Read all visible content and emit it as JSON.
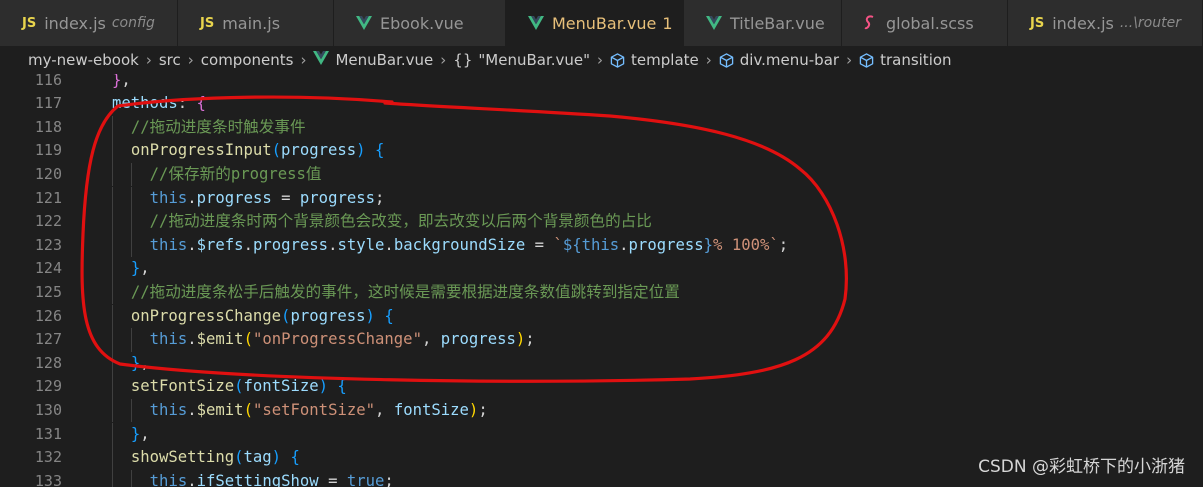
{
  "tabs": [
    {
      "icon": "js-file-icon",
      "label": "index.js",
      "description": "config",
      "active": false
    },
    {
      "icon": "js-file-icon",
      "label": "main.js",
      "active": false
    },
    {
      "icon": "vue-file-icon",
      "label": "Ebook.vue",
      "active": false
    },
    {
      "icon": "vue-file-icon",
      "label": "MenuBar.vue",
      "badge": "1",
      "active": true,
      "close": "✕"
    },
    {
      "icon": "vue-file-icon",
      "label": "TitleBar.vue",
      "active": false
    },
    {
      "icon": "scss-file-icon",
      "label": "global.scss",
      "active": false
    },
    {
      "icon": "js-file-icon",
      "label": "index.js",
      "description": "...\\router",
      "active": false
    }
  ],
  "breadcrumb": [
    "my-new-ebook",
    "src",
    "components",
    "MenuBar.vue",
    "\"MenuBar.vue\"",
    "template",
    "div.menu-bar",
    "transition"
  ],
  "code_lines": [
    {
      "num": "116",
      "indent": 0,
      "tokens": [
        [
          "}",
          "br1"
        ],
        [
          ",",
          "plain"
        ]
      ]
    },
    {
      "num": "117",
      "indent": 0,
      "tokens": [
        [
          "methods",
          "var"
        ],
        [
          ": ",
          "plain"
        ],
        [
          "{",
          "br1"
        ]
      ]
    },
    {
      "num": "118",
      "indent": 1,
      "tokens": [
        [
          "//拖动进度条时触发事件",
          "cmt"
        ]
      ]
    },
    {
      "num": "119",
      "indent": 1,
      "tokens": [
        [
          "onProgressInput",
          "fn"
        ],
        [
          "(",
          "br2"
        ],
        [
          "progress",
          "var"
        ],
        [
          ") ",
          "br2"
        ],
        [
          "{",
          "br2"
        ]
      ]
    },
    {
      "num": "120",
      "indent": 2,
      "tokens": [
        [
          "//保存新的progress值",
          "cmt"
        ]
      ]
    },
    {
      "num": "121",
      "indent": 2,
      "tokens": [
        [
          "this",
          "kw"
        ],
        [
          ".",
          "plain"
        ],
        [
          "progress",
          "var"
        ],
        [
          " = ",
          "plain"
        ],
        [
          "progress",
          "var"
        ],
        [
          ";",
          "plain"
        ]
      ]
    },
    {
      "num": "122",
      "indent": 2,
      "tokens": [
        [
          "//拖动进度条时两个背景颜色会改变，即去改变以后两个背景颜色的占比",
          "cmt"
        ]
      ]
    },
    {
      "num": "123",
      "indent": 2,
      "tokens": [
        [
          "this",
          "kw"
        ],
        [
          ".",
          "plain"
        ],
        [
          "$refs",
          "var"
        ],
        [
          ".",
          "plain"
        ],
        [
          "progress",
          "var"
        ],
        [
          ".",
          "plain"
        ],
        [
          "style",
          "var"
        ],
        [
          ".",
          "plain"
        ],
        [
          "backgroundSize",
          "var"
        ],
        [
          " = ",
          "plain"
        ],
        [
          "`",
          "str"
        ],
        [
          "${",
          "kw"
        ],
        [
          "this",
          "kw"
        ],
        [
          ".",
          "plain"
        ],
        [
          "progress",
          "var"
        ],
        [
          "}",
          "kw"
        ],
        [
          "% 100%`",
          "str"
        ],
        [
          ";",
          "plain"
        ]
      ]
    },
    {
      "num": "124",
      "indent": 1,
      "tokens": [
        [
          "}",
          "br2"
        ],
        [
          ",",
          "plain"
        ]
      ]
    },
    {
      "num": "125",
      "indent": 1,
      "tokens": [
        [
          "//拖动进度条松手后触发的事件，这时候是需要根据进度条数值跳转到指定位置",
          "cmt"
        ]
      ]
    },
    {
      "num": "126",
      "indent": 1,
      "tokens": [
        [
          "onProgressChange",
          "fn"
        ],
        [
          "(",
          "br2"
        ],
        [
          "progress",
          "var"
        ],
        [
          ") ",
          "br2"
        ],
        [
          "{",
          "br2"
        ]
      ]
    },
    {
      "num": "127",
      "indent": 2,
      "tokens": [
        [
          "this",
          "kw"
        ],
        [
          ".",
          "plain"
        ],
        [
          "$emit",
          "fn"
        ],
        [
          "(",
          "br3"
        ],
        [
          "\"onProgressChange\"",
          "str"
        ],
        [
          ", ",
          "plain"
        ],
        [
          "progress",
          "var"
        ],
        [
          ")",
          "br3"
        ],
        [
          ";",
          "plain"
        ]
      ]
    },
    {
      "num": "128",
      "indent": 1,
      "tokens": [
        [
          "}",
          "br2"
        ],
        [
          ",",
          "plain"
        ]
      ]
    },
    {
      "num": "129",
      "indent": 1,
      "tokens": [
        [
          "setFontSize",
          "fn"
        ],
        [
          "(",
          "br2"
        ],
        [
          "fontSize",
          "var"
        ],
        [
          ") ",
          "br2"
        ],
        [
          "{",
          "br2"
        ]
      ]
    },
    {
      "num": "130",
      "indent": 2,
      "tokens": [
        [
          "this",
          "kw"
        ],
        [
          ".",
          "plain"
        ],
        [
          "$emit",
          "fn"
        ],
        [
          "(",
          "br3"
        ],
        [
          "\"setFontSize\"",
          "str"
        ],
        [
          ", ",
          "plain"
        ],
        [
          "fontSize",
          "var"
        ],
        [
          ")",
          "br3"
        ],
        [
          ";",
          "plain"
        ]
      ]
    },
    {
      "num": "131",
      "indent": 1,
      "tokens": [
        [
          "}",
          "br2"
        ],
        [
          ",",
          "plain"
        ]
      ]
    },
    {
      "num": "132",
      "indent": 1,
      "tokens": [
        [
          "showSetting",
          "fn"
        ],
        [
          "(",
          "br2"
        ],
        [
          "tag",
          "var"
        ],
        [
          ") ",
          "br2"
        ],
        [
          "{",
          "br2"
        ]
      ]
    },
    {
      "num": "133",
      "indent": 2,
      "tokens": [
        [
          "this",
          "kw"
        ],
        [
          ".",
          "plain"
        ],
        [
          "ifSettingShow",
          "var"
        ],
        [
          " = ",
          "plain"
        ],
        [
          "true",
          "kw"
        ],
        [
          ";",
          "plain"
        ]
      ]
    }
  ],
  "watermark": "CSDN @彩虹桥下的小浙猪",
  "colors": {
    "annotation_circle": "#e01010",
    "active_tab_text": "#e8c07a",
    "vue_icon": "#41b883",
    "js_icon": "#e8d44d",
    "scss_icon": "#f55385"
  }
}
